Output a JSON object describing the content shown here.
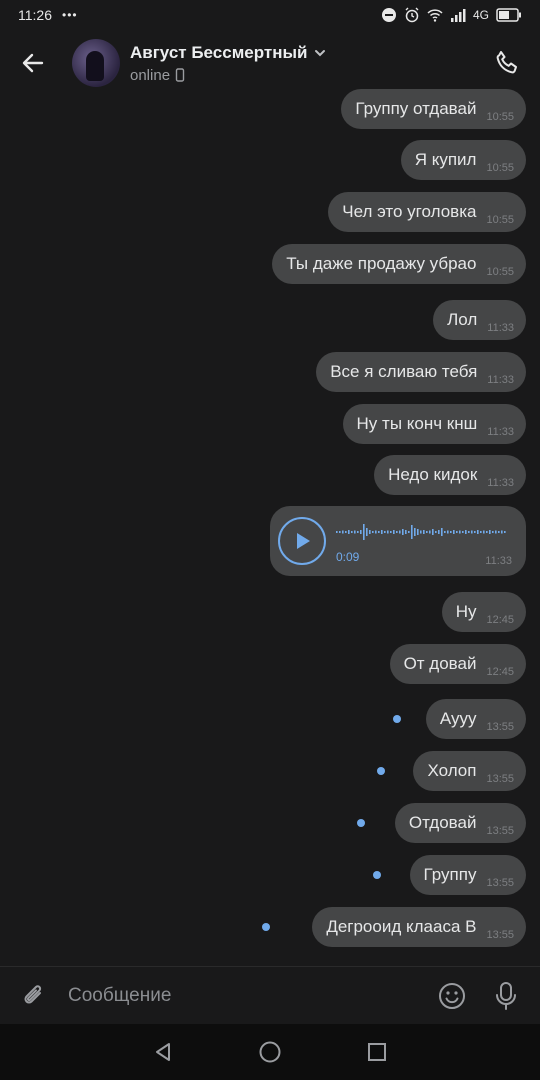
{
  "status_bar": {
    "time": "11:26",
    "extra": "•••",
    "network": "4G",
    "icons": [
      "dnd-icon",
      "alarm-icon",
      "wifi-icon",
      "signal-icon",
      "battery-icon"
    ]
  },
  "header": {
    "name": "Август Бессмертный",
    "status": "online",
    "back_icon": "arrow-left-icon",
    "call_icon": "phone-icon"
  },
  "messages": [
    {
      "text": "Группу отдавай",
      "time": "10:55",
      "unread": false
    },
    {
      "text": "Я купил",
      "time": "10:55",
      "unread": false
    },
    {
      "text": "Чел это уголовка",
      "time": "10:55",
      "unread": false
    },
    {
      "text": "Ты даже продажу убрао",
      "time": "10:55",
      "unread": false
    },
    {
      "text": "Лол",
      "time": "11:33",
      "unread": false
    },
    {
      "text": "Все я сливаю тебя",
      "time": "11:33",
      "unread": false
    },
    {
      "text": "Ну ты конч кнш",
      "time": "11:33",
      "unread": false
    },
    {
      "text": "Недо кидок",
      "time": "11:33",
      "unread": false
    },
    {
      "text": "Ну",
      "time": "12:45",
      "unread": false
    },
    {
      "text": "От довай",
      "time": "12:45",
      "unread": false
    },
    {
      "text": "Аууу",
      "time": "13:55",
      "unread": true
    },
    {
      "text": "Холоп",
      "time": "13:55",
      "unread": true
    },
    {
      "text": "Отдовай",
      "time": "13:55",
      "unread": true
    },
    {
      "text": "Группу",
      "time": "13:55",
      "unread": true
    },
    {
      "text": "Дегрооид клааса В",
      "time": "13:55",
      "unread": true
    }
  ],
  "voice_message": {
    "duration": "0:09",
    "time": "11:33"
  },
  "composer": {
    "placeholder": "Сообщение"
  },
  "colors": {
    "background": "#19191a",
    "bubble": "#454647",
    "accent": "#71aaeb"
  }
}
